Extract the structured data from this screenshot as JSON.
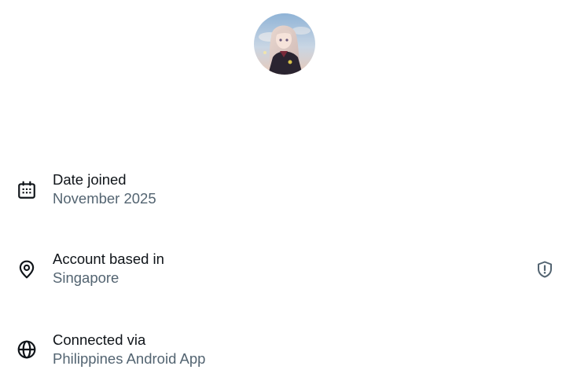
{
  "profile": {
    "avatar_icon": "profile-avatar"
  },
  "rows": [
    {
      "icon": "calendar-icon",
      "title": "Date joined",
      "value": "November 2025"
    },
    {
      "icon": "location-pin-icon",
      "title": "Account based in",
      "value": "Singapore",
      "action_icon": "shield-alert-icon"
    },
    {
      "icon": "globe-icon",
      "title": "Connected via",
      "value": "Philippines Android App"
    }
  ],
  "colors": {
    "primary_text": "#0f1419",
    "secondary_text": "#536471",
    "background": "#ffffff"
  }
}
